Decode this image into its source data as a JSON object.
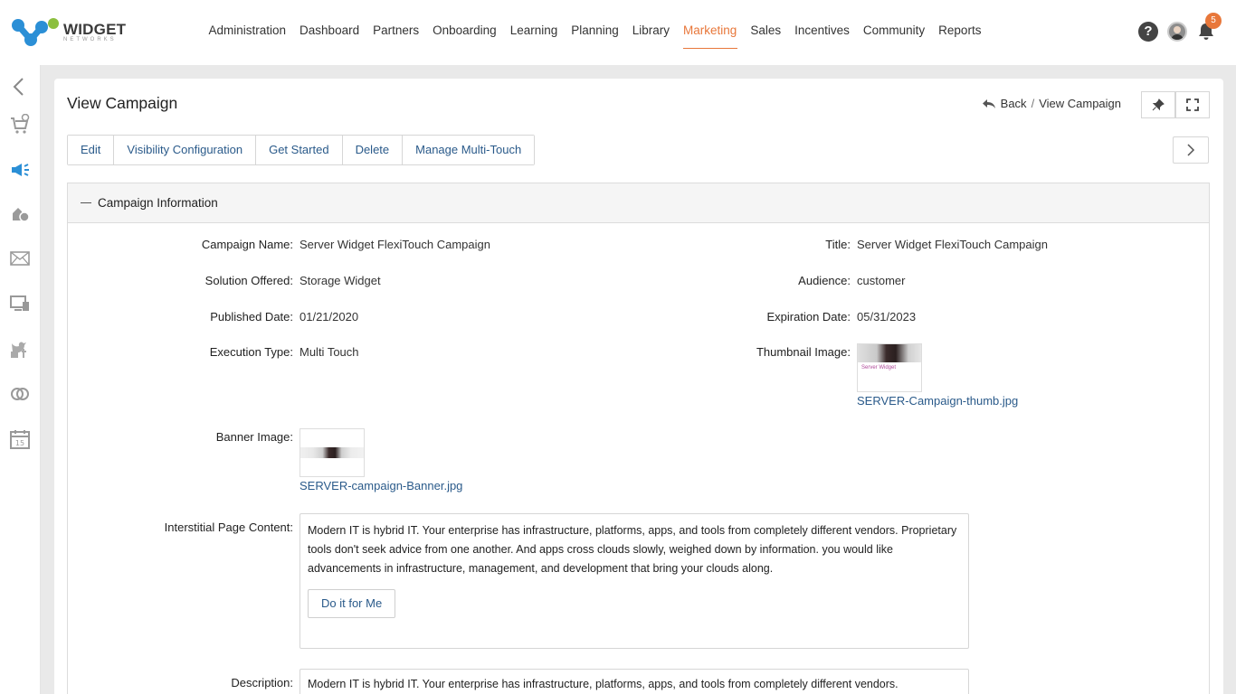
{
  "brand": {
    "name": "WIDGET",
    "sub": "NETWORKS"
  },
  "nav": [
    "Administration",
    "Dashboard",
    "Partners",
    "Onboarding",
    "Learning",
    "Planning",
    "Library",
    "Marketing",
    "Sales",
    "Incentives",
    "Community",
    "Reports"
  ],
  "nav_active": "Marketing",
  "notifications": {
    "count": "5"
  },
  "help_glyph": "?",
  "colors": {
    "accent": "#e8773a",
    "link": "#2a5a8a",
    "sidebar_active": "#2b8fd6"
  },
  "sidebar_icons": [
    "chevron-left-icon",
    "cart-add-icon",
    "megaphone-icon",
    "incentive-icon",
    "mail-icon",
    "devices-icon",
    "social-icon",
    "link-icon",
    "calendar-icon"
  ],
  "page": {
    "title": "View Campaign",
    "breadcrumb": {
      "back": "Back",
      "sep": "/",
      "current": "View Campaign"
    }
  },
  "toolbar": [
    "Edit",
    "Visibility Configuration",
    "Get Started",
    "Delete",
    "Manage Multi-Touch"
  ],
  "section": {
    "title": "Campaign Information",
    "fields": {
      "campaign_name_label": "Campaign Name:",
      "campaign_name": "Server Widget FlexiTouch Campaign",
      "title_label": "Title:",
      "title": "Server Widget FlexiTouch Campaign",
      "solution_label": "Solution Offered:",
      "solution": "Storage Widget",
      "audience_label": "Audience:",
      "audience": "customer",
      "published_label": "Published Date:",
      "published": "01/21/2020",
      "expiration_label": "Expiration Date:",
      "expiration": "05/31/2023",
      "execution_label": "Execution Type:",
      "execution": "Multi Touch",
      "thumbnail_label": "Thumbnail Image:",
      "thumbnail_file": "SERVER-Campaign-thumb.jpg",
      "thumbnail_caption": "Server Widget",
      "banner_label": "Banner Image:",
      "banner_file": "SERVER-campaign-Banner.jpg",
      "interstitial_label": "Interstitial Page Content:",
      "interstitial_text": "Modern IT is hybrid IT. Your enterprise has infrastructure, platforms, apps, and tools from completely different vendors. Proprietary tools don't seek advice from one another. And apps cross clouds slowly, weighed down by information. you would like advancements in infrastructure, management, and development that bring your clouds along.",
      "interstitial_cta": "Do it for Me",
      "description_label": "Description:",
      "description_text": "Modern IT is hybrid IT. Your enterprise has infrastructure, platforms, apps, and tools from completely different vendors."
    }
  }
}
